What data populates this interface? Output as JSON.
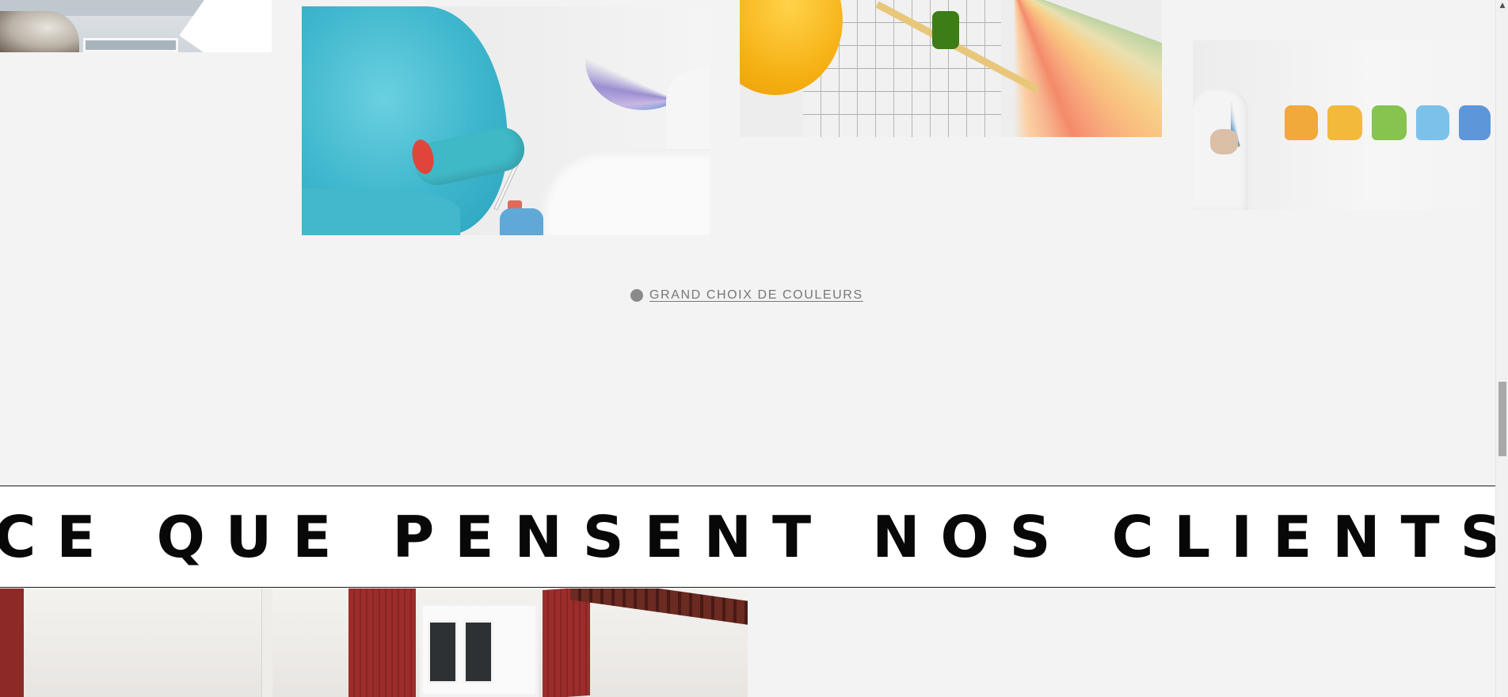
{
  "gallery": {
    "caption": "GRAND CHOIX DE COULEURS",
    "images": [
      {
        "name": "house-painter-image"
      },
      {
        "name": "blue-paint-roller-image"
      },
      {
        "name": "color-swatches-plans-image"
      },
      {
        "name": "paint-strokes-image"
      }
    ]
  },
  "testimonials": {
    "heading": "CE QUE PENSENT NOS CLIENTS"
  },
  "colors": {
    "background": "#f3f3f3",
    "heading_text": "#080808",
    "caption_text": "#777777",
    "shutter_red": "#9c2d2b"
  },
  "scrollbar": {
    "up_arrow": "▲"
  }
}
